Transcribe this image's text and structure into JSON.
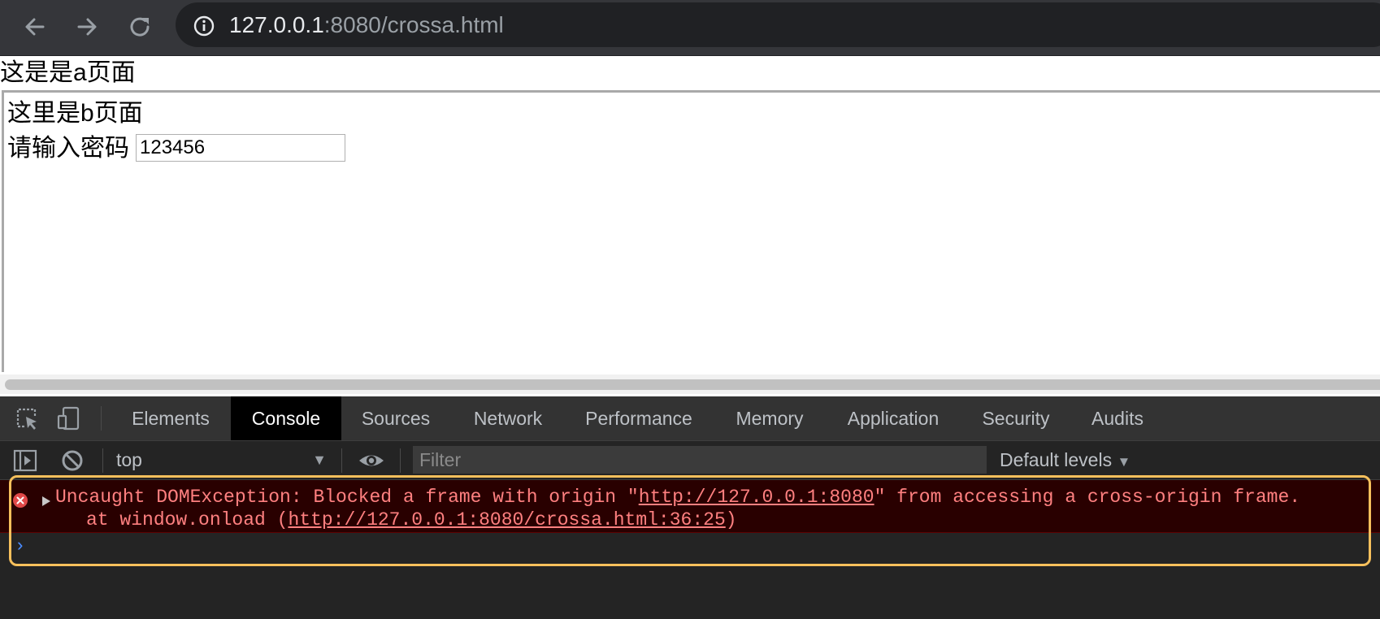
{
  "browser": {
    "url_host": "127.0.0.1",
    "url_rest": ":8080/crossa.html"
  },
  "page": {
    "title_a": "这是是a页面",
    "iframe": {
      "title_b": "这里是b页面",
      "password_label": "请输入密码",
      "password_value": "123456"
    }
  },
  "devtools": {
    "tabs": [
      "Elements",
      "Console",
      "Sources",
      "Network",
      "Performance",
      "Memory",
      "Application",
      "Security",
      "Audits"
    ],
    "active_tab": "Console",
    "context": "top",
    "filter_placeholder": "Filter",
    "levels": "Default levels",
    "error": {
      "line1_prefix": "Uncaught DOMException: Blocked a frame with origin \"",
      "line1_link": "http://127.0.0.1:8080",
      "line1_suffix": "\" from accessing a cross-origin frame.",
      "line2_prefix": "at window.onload (",
      "line2_link": "http://127.0.0.1:8080/crossa.html:36:25",
      "line2_suffix": ")"
    },
    "prompt": "›"
  },
  "colors": {
    "error_text": "#ff8080",
    "error_bg": "#290000",
    "highlight": "#f7c05c",
    "active_tab_bg": "#000000"
  }
}
